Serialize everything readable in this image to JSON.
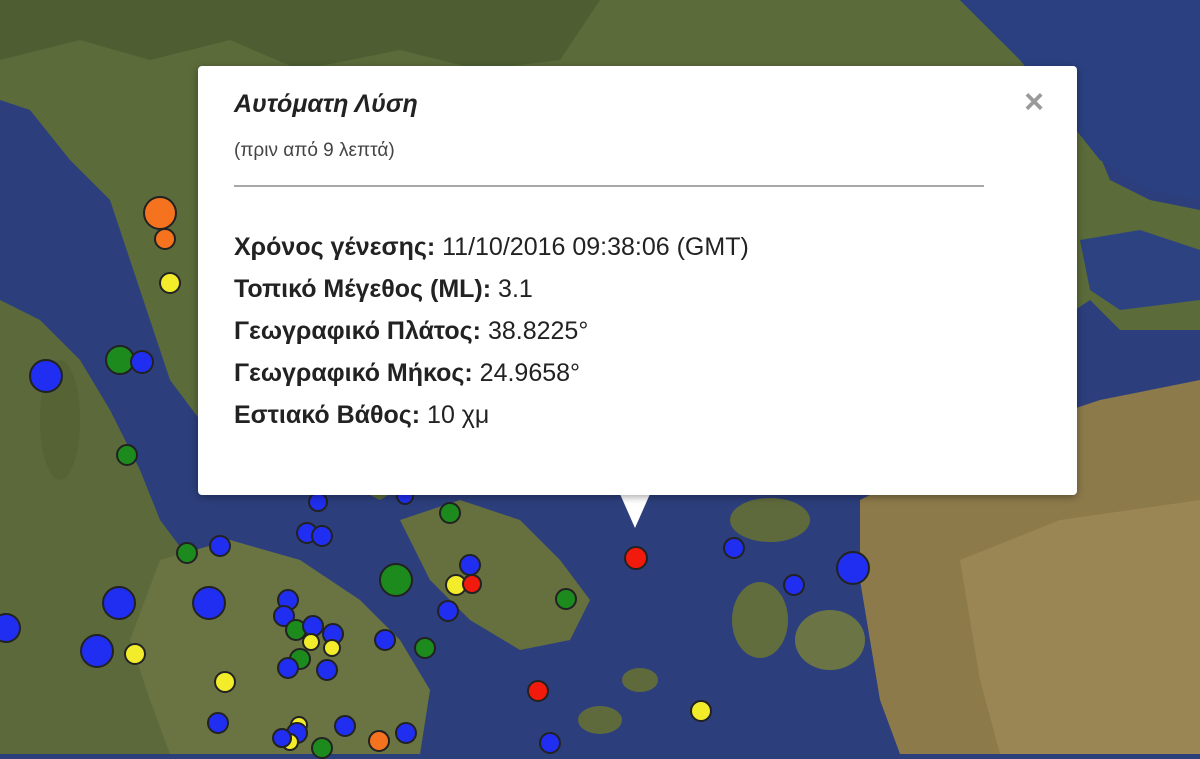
{
  "popup": {
    "title": "Αυτόματη Λύση",
    "subtitle": "(πριν από 9 λεπτά)",
    "close_glyph": "×",
    "rows": [
      {
        "label": "Χρόνος γένεσης:",
        "value": " 11/10/2016  09:38:06 (GMT)"
      },
      {
        "label": "Τοπικό Μέγεθος (ML):",
        "value": " 3.1"
      },
      {
        "label": "Γεωγραφικό Πλάτος:",
        "value": " 38.8225°"
      },
      {
        "label": "Γεωγραφικό Μήκος:",
        "value": " 24.9658°"
      },
      {
        "label": "Εστιακό Βάθος:",
        "value": " 10 χμ"
      }
    ]
  },
  "legend_colors": {
    "red": "#f21a0c",
    "orange": "#f5731e",
    "yellow": "#f2ec2a",
    "green": "#1d8a1d",
    "blue": "#1f2ef0"
  },
  "icons": {
    "close": "close-icon",
    "marker": "earthquake-marker-icon"
  }
}
